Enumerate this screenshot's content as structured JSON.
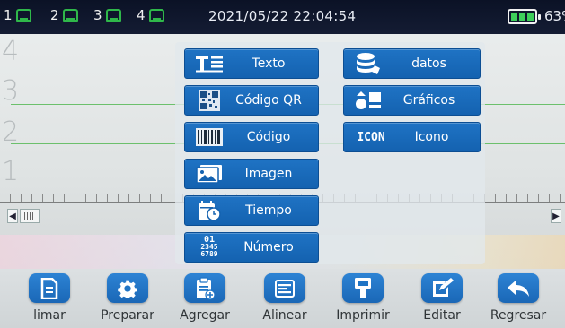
{
  "status": {
    "printers": [
      {
        "number": "1",
        "icon": "printhead-icon"
      },
      {
        "number": "2",
        "icon": "printhead-icon"
      },
      {
        "number": "3",
        "icon": "printhead-icon"
      },
      {
        "number": "4",
        "icon": "printhead-icon"
      }
    ],
    "datetime": "2021/05/22 22:04:54",
    "battery_percent": "63%",
    "battery_level": 1.0
  },
  "canvas": {
    "row_numbers": [
      "4",
      "3",
      "2",
      "1"
    ]
  },
  "menu": {
    "items": [
      {
        "label": "Texto",
        "icon": "text-icon"
      },
      {
        "label": "datos",
        "icon": "database-icon"
      },
      {
        "label": "Código QR",
        "icon": "qr-code-icon"
      },
      {
        "label": "Gráficos",
        "icon": "graphics-icon"
      },
      {
        "label": "Código",
        "icon": "barcode-icon"
      },
      {
        "label": "Icono",
        "icon": "icon-icon",
        "icon_text": "ICON"
      },
      {
        "label": "Imagen",
        "icon": "image-icon"
      },
      {
        "label": "Tiempo",
        "icon": "calendar-clock-icon"
      },
      {
        "label": "Número",
        "icon": "number-icon",
        "icon_text": [
          "01",
          "2345",
          "6789"
        ]
      }
    ]
  },
  "toolbar": {
    "items": [
      {
        "label": "limar",
        "icon": "document-icon"
      },
      {
        "label": "Preparar",
        "icon": "gear-icon"
      },
      {
        "label": "Agregar",
        "icon": "clipboard-add-icon"
      },
      {
        "label": "Alinear",
        "icon": "align-left-icon"
      },
      {
        "label": "Imprimir",
        "icon": "print-handle-icon"
      },
      {
        "label": "Editar",
        "icon": "edit-icon"
      },
      {
        "label": "Regresar",
        "icon": "return-arrow-icon"
      }
    ]
  },
  "colors": {
    "accent": "#1a67b6",
    "status_green": "#2fb84a",
    "battery_green": "#3ecf5a",
    "statusbar_bg": "#0b1226"
  }
}
